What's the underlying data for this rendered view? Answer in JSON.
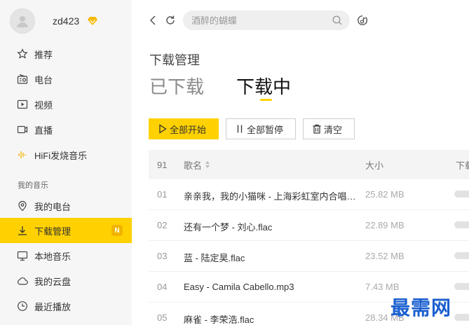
{
  "user": {
    "name": "zd423"
  },
  "sidebar": {
    "items": [
      {
        "label": "推荐",
        "icon": "star-icon"
      },
      {
        "label": "电台",
        "icon": "radio-icon"
      },
      {
        "label": "视频",
        "icon": "video-icon"
      },
      {
        "label": "直播",
        "icon": "live-icon"
      },
      {
        "label": "HiFi发烧音乐",
        "icon": "hifi-icon"
      }
    ],
    "section_label": "我的音乐",
    "my_items": [
      {
        "label": "我的电台",
        "icon": "location-icon"
      },
      {
        "label": "下载管理",
        "icon": "download-icon",
        "badge": "N",
        "active": true
      },
      {
        "label": "本地音乐",
        "icon": "monitor-icon"
      },
      {
        "label": "我的云盘",
        "icon": "cloud-icon"
      },
      {
        "label": "最近播放",
        "icon": "clock-icon"
      }
    ]
  },
  "search": {
    "placeholder": "酒醉的蝴蝶"
  },
  "page": {
    "title": "下载管理",
    "tabs": [
      {
        "label": "已下载"
      },
      {
        "label": "下载中"
      }
    ]
  },
  "buttons": {
    "start_all": "全部开始",
    "pause_all": "全部暂停",
    "clear": "清空"
  },
  "table": {
    "count": "91",
    "col_name": "歌名",
    "col_size": "大小",
    "col_progress": "下载进度",
    "rows": [
      {
        "num": "01",
        "name": "亲亲我，我的小猫咪 - 上海彩虹室内合唱团.flac",
        "size": "25.82 MB",
        "progress": 0.6
      },
      {
        "num": "02",
        "name": "还有一个梦 - 刘心.flac",
        "size": "22.89 MB",
        "progress": 0.6
      },
      {
        "num": "03",
        "name": "蓝 - 陆定昊.flac",
        "size": "23.52 MB",
        "progress": 0
      },
      {
        "num": "04",
        "name": "Easy - Camila Cabello.mp3",
        "size": "7.43 MB",
        "progress": 0
      },
      {
        "num": "05",
        "name": "麻雀 - 李荣浩.flac",
        "size": "28.34 MB",
        "progress": 0
      }
    ]
  },
  "watermark": "最需网",
  "colors": {
    "accent": "#ffd100",
    "watermark": "#1a5fd0"
  }
}
